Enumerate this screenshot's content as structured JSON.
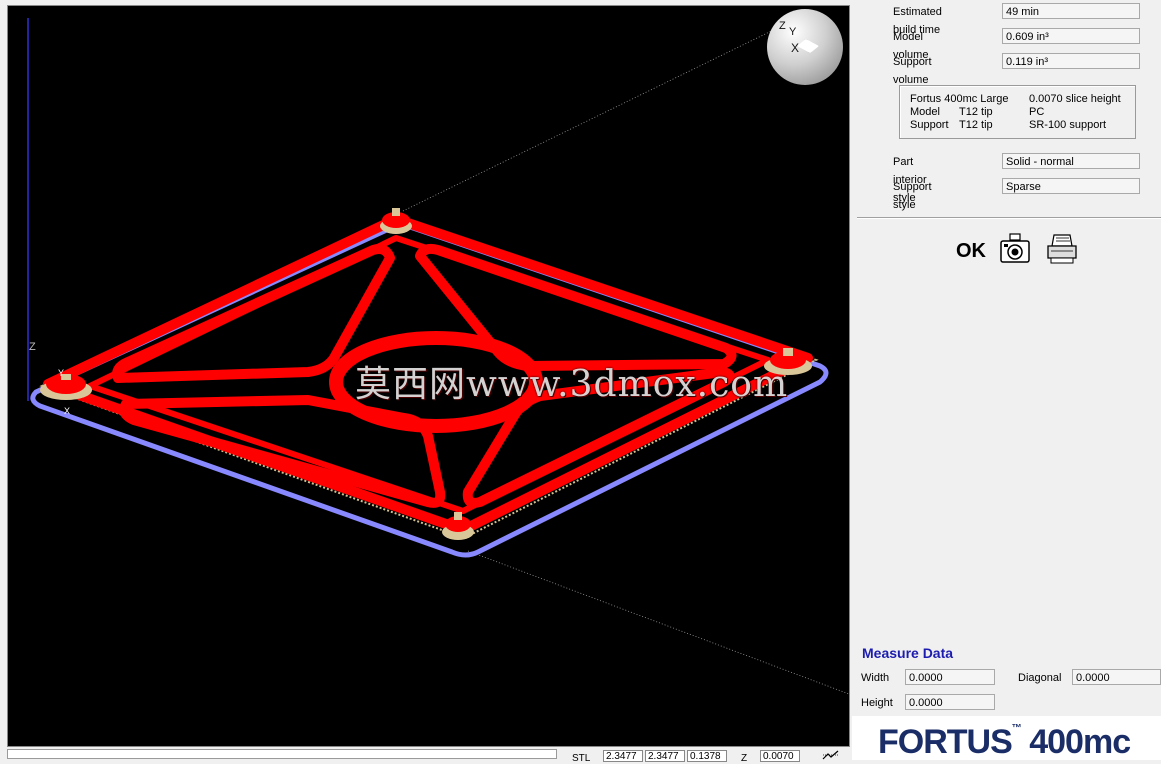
{
  "viewport": {
    "axis_label_z": "Z",
    "cube": {
      "z": "Z",
      "y": "Y",
      "x": "X"
    },
    "corner_axes": {
      "y": "Y",
      "x": "X"
    },
    "watermark": "莫西网www.3dmox.com"
  },
  "build_info": {
    "estimated_build_time_label": "Estimated build time",
    "estimated_build_time": "49 min",
    "model_volume_label": "Model volume",
    "model_volume": "0.609 in³",
    "support_volume_label": "Support volume",
    "support_volume": "0.119 in³"
  },
  "machine": {
    "name": "Fortus 400mc Large",
    "slice_height": "0.0070 slice height",
    "model_label": "Model",
    "model_tip": "T12 tip",
    "model_material": "PC",
    "support_label": "Support",
    "support_tip": "T12 tip",
    "support_material": "SR-100 support"
  },
  "styles": {
    "part_interior_label": "Part interior style",
    "part_interior": "Solid - normal",
    "support_style_label": "Support style",
    "support_style": "Sparse"
  },
  "actions": {
    "ok_label": "OK"
  },
  "measure": {
    "title": "Measure Data",
    "width_label": "Width",
    "width": "0.0000",
    "diagonal_label": "Diagonal",
    "diagonal": "0.0000",
    "height_label": "Height",
    "height": "0.0000"
  },
  "logo": {
    "brand": "FORTUS",
    "model": "400mc"
  },
  "statusbar": {
    "stl_label": "STL",
    "x": "2.3477",
    "y": "2.3477",
    "zval": "0.1378",
    "z_label": "Z",
    "zslice": "0.0070"
  },
  "colors": {
    "part": "#ff0000",
    "support": "#ccbb88",
    "base": "#8888ff",
    "background": "#000000"
  }
}
